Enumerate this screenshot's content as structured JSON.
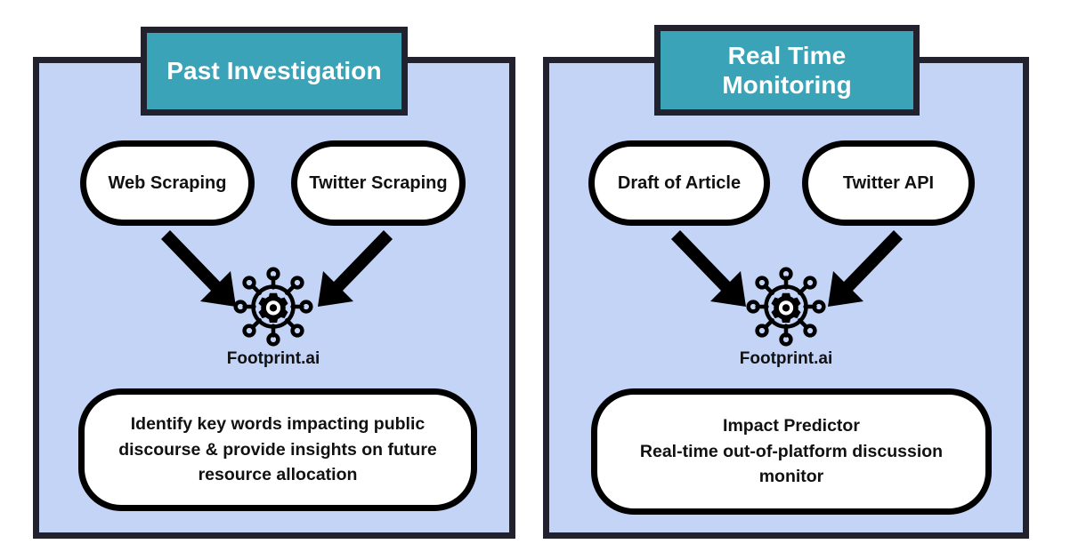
{
  "diagram": {
    "background_color": "#ffffff",
    "panel_fill": "#c3d4f7",
    "panel_border": "#22222e",
    "header_fill": "#3ba3b8",
    "header_text_color": "#ffffff",
    "node_fill": "#ffffff",
    "node_border": "#000000",
    "arrow_color": "#000000"
  },
  "panels": [
    {
      "id": "past-investigation",
      "header": "Past Investigation",
      "sources": [
        {
          "label": "Web Scraping"
        },
        {
          "label": "Twitter Scraping"
        }
      ],
      "hub": {
        "icon": "gear-network-icon",
        "caption": "Footprint.ai"
      },
      "outcome": "Identify key words impacting public\ndiscourse & provide insights on future\nresource allocation"
    },
    {
      "id": "real-time-monitoring",
      "header": "Real Time\nMonitoring",
      "sources": [
        {
          "label": "Draft of Article"
        },
        {
          "label": "Twitter API"
        }
      ],
      "hub": {
        "icon": "gear-network-icon",
        "caption": "Footprint.ai"
      },
      "outcome": "Impact Predictor\nReal-time out-of-platform discussion\nmonitor"
    }
  ]
}
